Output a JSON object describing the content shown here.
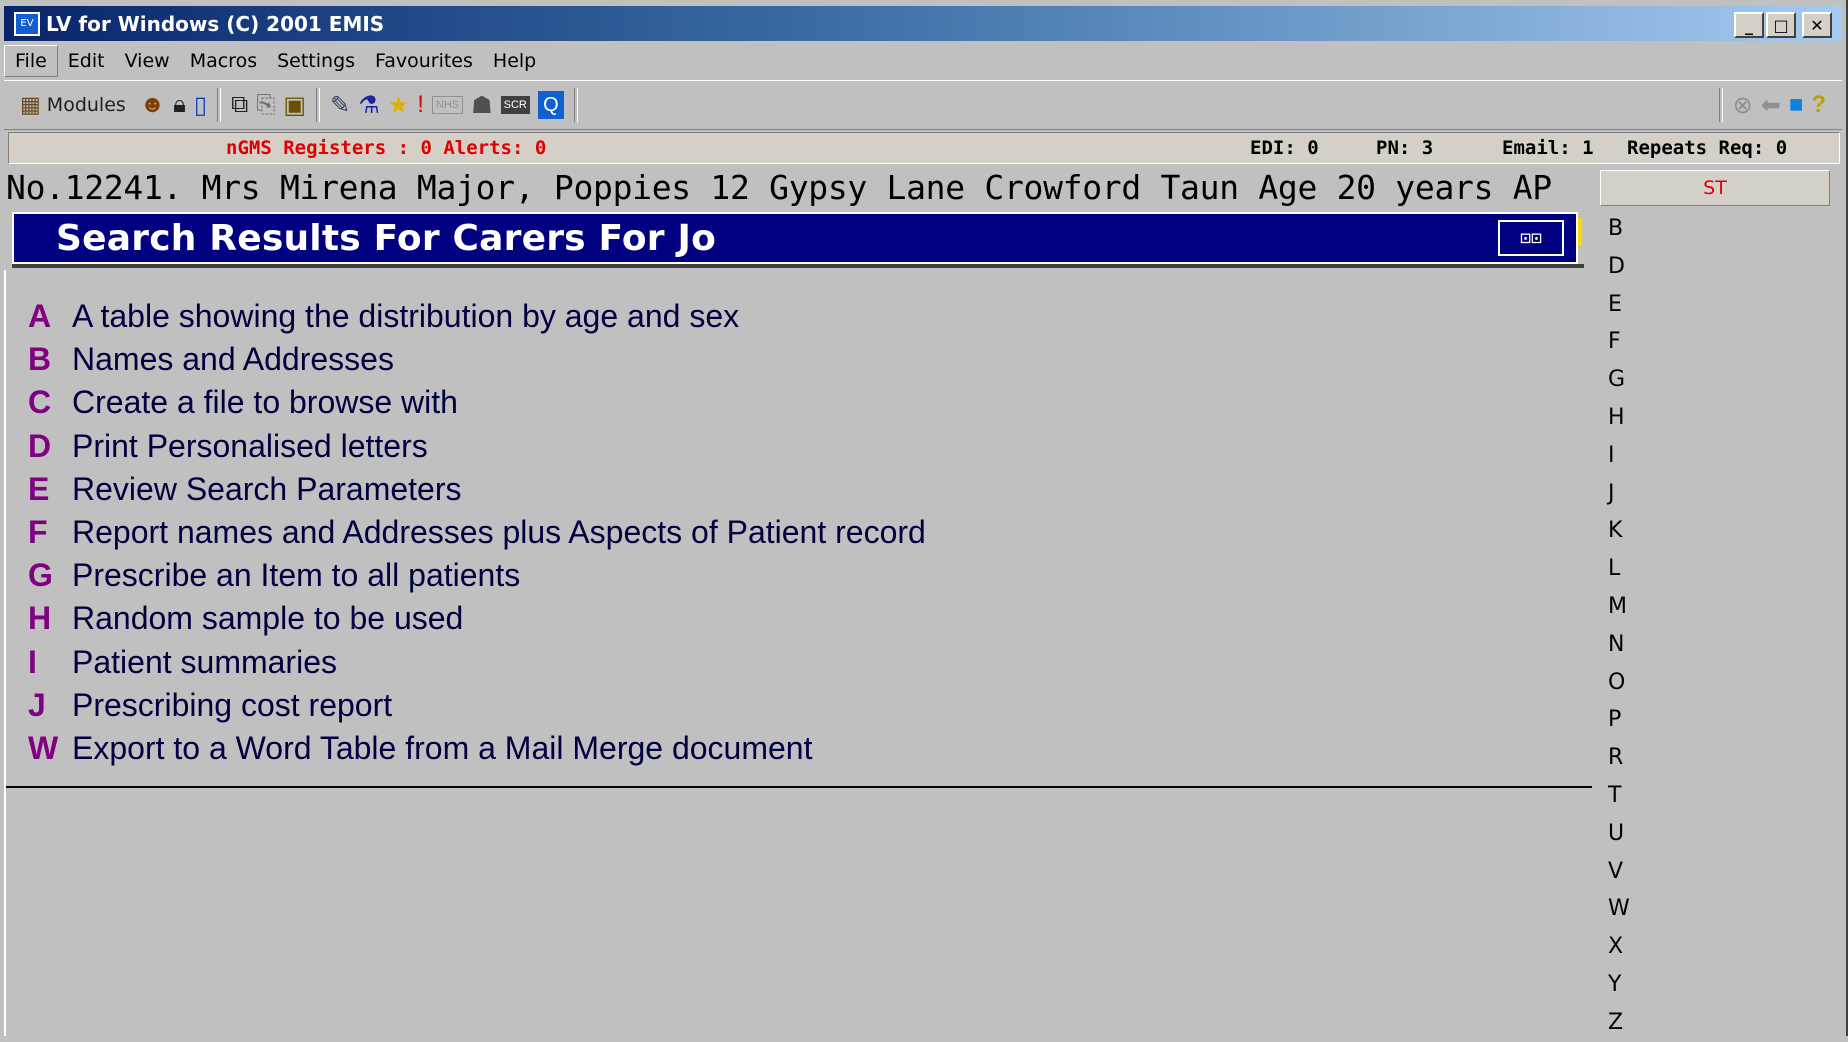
{
  "window": {
    "title": "LV for Windows (C) 2001 EMIS",
    "icon_text": "EV",
    "buttons": {
      "minimize": "_",
      "maximize": "□",
      "close": "✕"
    }
  },
  "menu": {
    "items": [
      {
        "label": "File"
      },
      {
        "label": "Edit"
      },
      {
        "label": "View"
      },
      {
        "label": "Macros"
      },
      {
        "label": "Settings"
      },
      {
        "label": "Favourites"
      },
      {
        "label": "Help"
      }
    ]
  },
  "toolbar": {
    "modules_label": "Modules",
    "icons": [
      "people-icon",
      "lock-icon",
      "phone-icon",
      "copy-icon",
      "paste-icon",
      "clipboard-icon",
      "pen-icon",
      "flask-icon",
      "star-icon",
      "alert-icon",
      "nhs-icon",
      "group-icon",
      "scr-icon",
      "query-icon"
    ],
    "right_icons": [
      "stop-icon",
      "back-arrow-icon",
      "window-icon",
      "help-icon"
    ]
  },
  "status": {
    "alerts": "nGMS Registers : 0  Alerts: 0",
    "edi": "EDI: 0",
    "pn": "PN: 3",
    "email": "Email: 1",
    "repeats": "Repeats Req: 0"
  },
  "patient": {
    "line": "No.12241. Mrs Mirena Major, Poppies 12 Gypsy Lane Crowford Taun  Age 20 years AP"
  },
  "side_panel": {
    "tab": "ST",
    "letters": [
      "B",
      "D",
      "E",
      "F",
      "G",
      "H",
      "I",
      "J",
      "K",
      "L",
      "M",
      "N",
      "O",
      "P",
      "R",
      "T",
      "U",
      "V",
      "W",
      "X",
      "Y",
      "Z"
    ]
  },
  "page": {
    "title": "Search Results For Carers For Jo",
    "options": [
      {
        "key": "A",
        "label": "A table showing the distribution by age and sex"
      },
      {
        "key": "B",
        "label": "Names and Addresses"
      },
      {
        "key": "C",
        "label": "Create a file to browse with"
      },
      {
        "key": "D",
        "label": "Print Personalised letters"
      },
      {
        "key": "E",
        "label": "Review Search Parameters"
      },
      {
        "key": "F",
        "label": "Report names and Addresses plus Aspects of Patient record"
      },
      {
        "key": "G",
        "label": "Prescribe an Item to all patients"
      },
      {
        "key": "H",
        "label": "Random sample to be used"
      },
      {
        "key": "I",
        "label": "Patient summaries"
      },
      {
        "key": "J",
        "label": "Prescribing cost report"
      },
      {
        "key": "W",
        "label": "Export to a Word Table from a Mail Merge document"
      }
    ]
  }
}
